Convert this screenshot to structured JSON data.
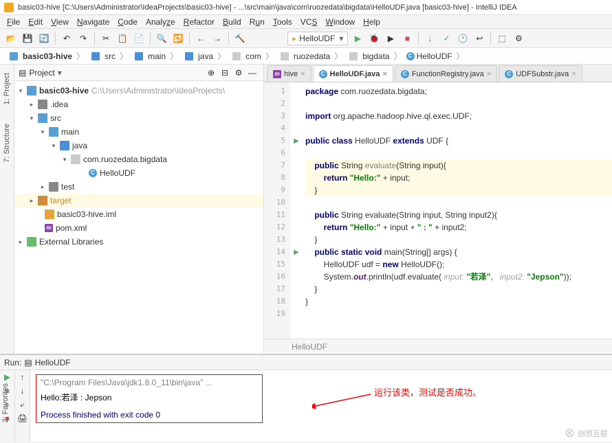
{
  "title": "basic03-hive [C:\\Users\\Administrator\\IdeaProjects\\basic03-hive] - ...\\src\\main\\java\\com\\ruozedata\\bigdata\\HelloUDF.java [basic03-hive] - IntelliJ IDEA",
  "menu": [
    "File",
    "Edit",
    "View",
    "Navigate",
    "Code",
    "Analyze",
    "Refactor",
    "Build",
    "Run",
    "Tools",
    "VCS",
    "Window",
    "Help"
  ],
  "run_config": "HelloUDF",
  "breadcrumb": [
    "basic03-hive",
    "src",
    "main",
    "java",
    "com",
    "ruozedata",
    "bigdata",
    "HelloUDF"
  ],
  "project_panel": {
    "title": "Project"
  },
  "tree": {
    "root": {
      "name": "basic03-hive",
      "path": "C:\\Users\\Administrator\\IdeaProjects\\",
      "expanded": true
    },
    "idea": ".idea",
    "src": "src",
    "main_dir": "main",
    "java_dir": "java",
    "pkg": "com.ruozedata.bigdata",
    "cls": "HelloUDF",
    "test": "test",
    "target": "target",
    "iml": "basic03-hive.iml",
    "pom": "pom.xml",
    "ext": "External Libraries"
  },
  "tabs": [
    {
      "label": "hive",
      "icon": "m"
    },
    {
      "label": "HelloUDF.java",
      "icon": "c",
      "active": true
    },
    {
      "label": "FunctionRegistry.java",
      "icon": "c"
    },
    {
      "label": "UDFSubstr.java",
      "icon": "c"
    }
  ],
  "code": {
    "l1_kw": "package",
    "l1_rest": " com.ruozedata.bigdata;",
    "l3_kw": "import",
    "l3_rest": " org.apache.hadoop.hive.ql.exec.UDF;",
    "l5_kw1": "public class",
    "l5_name": " HelloUDF ",
    "l5_kw2": "extends",
    "l5_rest": " UDF {",
    "l7_kw": "public",
    "l7_rest": " String ",
    "l7_m": "evaluate",
    "l7_sig": "(String input){",
    "l8_kw": "return ",
    "l8_str": "\"Hello:\"",
    "l8_rest": " + input;",
    "l9": "}",
    "l11_kw": "public",
    "l11_rest": " String evaluate(String input, String input2){",
    "l12_kw": "return ",
    "l12_str1": "\"Hello:\"",
    "l12_mid": " + input + ",
    "l12_str2": "\" : \"",
    "l12_rest": " + input2;",
    "l13": "}",
    "l14_kw": "public static void",
    "l14_rest": " main(String[] args) {",
    "l15_a": "HelloUDF udf = ",
    "l15_kw": "new",
    "l15_b": " HelloUDF();",
    "l16_a": "System.",
    "l16_out": "out",
    "l16_b": ".println(udf.evaluate( ",
    "l16_h1": "input: ",
    "l16_s1": "\"若泽\"",
    "l16_c": ",   ",
    "l16_h2": "input2: ",
    "l16_s2": "\"Jepson\"",
    "l16_d": "));",
    "l17": "}",
    "l18": "}"
  },
  "editor_footer": "HelloUDF",
  "run": {
    "header_label": "Run:",
    "config": "HelloUDF",
    "cmd": "\"C:\\Program Files\\Java\\jdk1.8.0_11\\bin\\java\" ...",
    "output": "Hello:若泽 : Jepson",
    "exit": "Process finished with exit code 0"
  },
  "annotation": "运行该类，测试是否成功。",
  "side_tabs": {
    "project": "1: Project",
    "structure": "7: Structure",
    "favorites": "2: Favorites"
  },
  "watermark": "创想互联"
}
